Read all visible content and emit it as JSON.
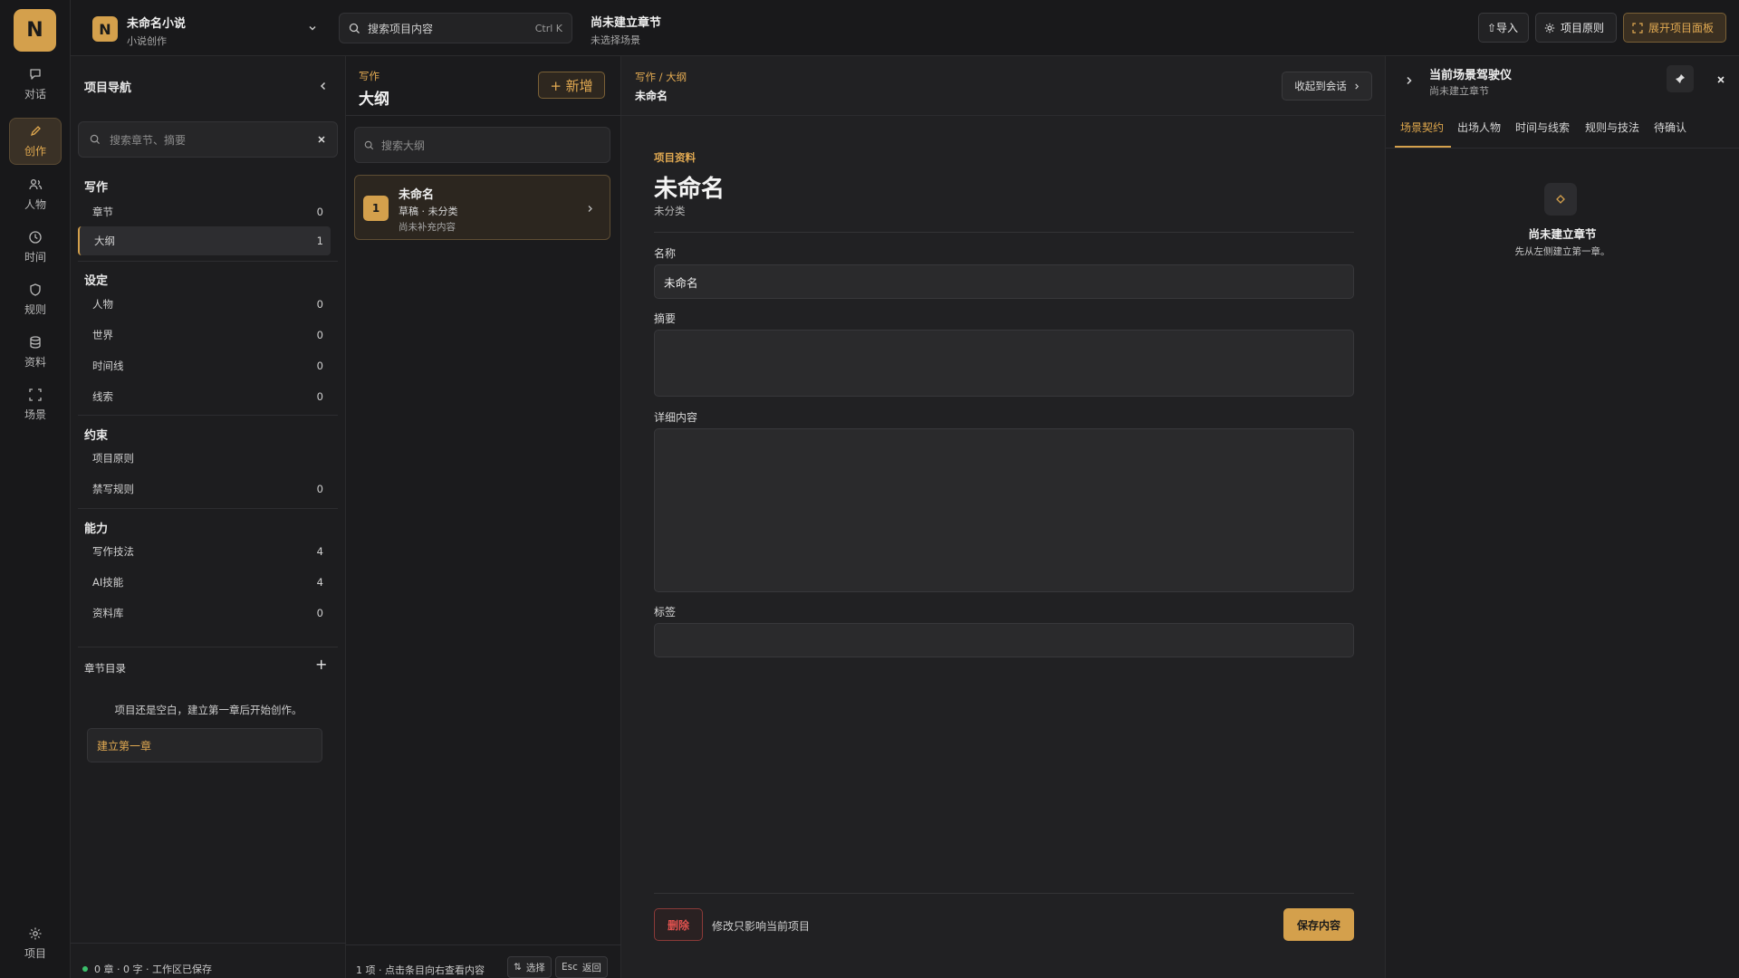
{
  "rail": {
    "logo": "N",
    "items": [
      {
        "label": "对话",
        "icon": "chat-icon"
      },
      {
        "label": "创作",
        "icon": "pencil-icon"
      },
      {
        "label": "人物",
        "icon": "users-icon"
      },
      {
        "label": "时间",
        "icon": "clock-icon"
      },
      {
        "label": "规则",
        "icon": "shield-icon"
      },
      {
        "label": "资料",
        "icon": "database-icon"
      },
      {
        "label": "场景",
        "icon": "frame-icon"
      }
    ],
    "bottom": {
      "label": "项目",
      "icon": "gear-icon"
    }
  },
  "topbar": {
    "project_badge": "N",
    "project_name": "未命名小说",
    "project_type": "小说创作",
    "search_placeholder": "搜索项目内容",
    "search_shortcut": "Ctrl K",
    "chapter_title": "尚未建立章节",
    "chapter_sub": "未选择场景",
    "import_label": "⇧导入",
    "principles_label": "项目原则",
    "expand_label": "展开项目面板"
  },
  "nav": {
    "title": "项目导航",
    "search_placeholder": "搜索章节、摘要",
    "sections": [
      {
        "title": "写作",
        "items": [
          {
            "label": "章节",
            "count": "0"
          },
          {
            "label": "大纲",
            "count": "1"
          }
        ]
      },
      {
        "title": "设定",
        "items": [
          {
            "label": "人物",
            "count": "0"
          },
          {
            "label": "世界",
            "count": "0"
          },
          {
            "label": "时间线",
            "count": "0"
          },
          {
            "label": "线索",
            "count": "0"
          }
        ]
      },
      {
        "title": "约束",
        "items": [
          {
            "label": "项目原则",
            "count": ""
          },
          {
            "label": "禁写规则",
            "count": "0"
          }
        ]
      },
      {
        "title": "能力",
        "items": [
          {
            "label": "写作技法",
            "count": "4"
          },
          {
            "label": "AI技能",
            "count": "4"
          },
          {
            "label": "资料库",
            "count": "0"
          }
        ]
      }
    ],
    "toc_title": "章节目录",
    "toc_add": "+",
    "empty_text": "项目还是空白，建立第一章后开始创作。",
    "create_first": "建立第一章",
    "status": "0 章 · 0 字 · 工作区已保存"
  },
  "list": {
    "crumb": "写作",
    "title": "大纲",
    "add_label": "+ 新增",
    "search_placeholder": "搜索大纲",
    "items": [
      {
        "index": "1",
        "title": "未命名",
        "meta": "草稿 · 未分类",
        "desc": "尚未补充内容"
      }
    ],
    "footer_count": "1 项 · 点击条目向右查看内容",
    "footer_select_key": "⇅",
    "footer_select": "选择",
    "footer_back_key": "Esc",
    "footer_back": "返回"
  },
  "main": {
    "breadcrumb": "写作 / 大纲",
    "title_small": "未命名",
    "collapse_label": "收起到会话",
    "section_label": "项目资料",
    "title": "未命名",
    "category": "未分类",
    "name_label": "名称",
    "name_value": "未命名",
    "summary_label": "摘要",
    "summary_value": "",
    "detail_label": "详细内容",
    "detail_value": "",
    "tags_label": "标签",
    "tags_value": "",
    "delete_label": "删除",
    "note": "修改只影响当前项目",
    "save_label": "保存内容"
  },
  "right": {
    "title": "当前场景驾驶仪",
    "subtitle": "尚未建立章节",
    "tabs": [
      "场景契约",
      "出场人物",
      "时间与线索",
      "规则与技法",
      "待确认"
    ],
    "empty_title": "尚未建立章节",
    "empty_desc": "先从左侧建立第一章。"
  },
  "colors": {
    "accent": "#d4a04c",
    "danger": "#e0524f",
    "status_ok": "#3bbf6b"
  }
}
